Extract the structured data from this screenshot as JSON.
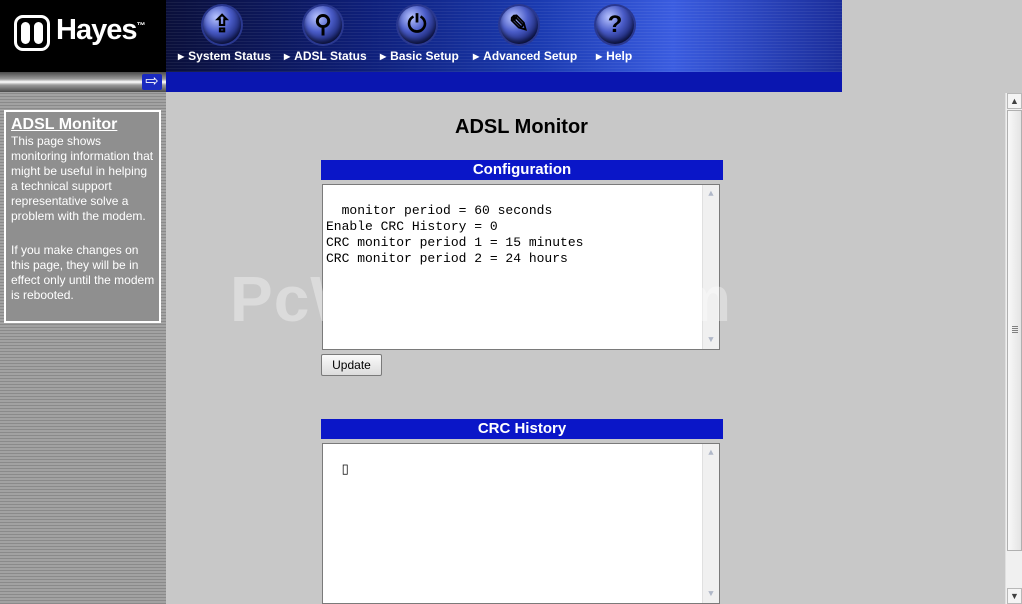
{
  "header": {
    "brand": "Hayes",
    "brand_mark": "™",
    "nav": [
      {
        "label": "System Status",
        "icon": "folder-icon",
        "glyph": "⇪"
      },
      {
        "label": "ADSL Status",
        "icon": "magnifier-icon",
        "glyph": "⚲"
      },
      {
        "label": "Basic Setup",
        "icon": "plug-icon",
        "glyph": "⏻"
      },
      {
        "label": "Advanced Setup",
        "icon": "wrench-icon",
        "glyph": "✎"
      },
      {
        "label": "Help",
        "icon": "question-icon",
        "glyph": "?"
      }
    ],
    "nav_bullet": "▶",
    "subbar_arrow": "⇨"
  },
  "sidebar": {
    "title": "ADSL Monitor",
    "p1": "This page shows monitoring information that might be useful in helping a technical support representative solve a problem with the modem.",
    "p2": "If you make changes on this page, they will be in effect only until the modem is rebooted."
  },
  "main": {
    "title": "ADSL Monitor",
    "configuration": {
      "header": "Configuration",
      "text": "monitor period = 60 seconds\nEnable CRC History = 0\nCRC monitor period 1 = 15 minutes\nCRC monitor period 2 = 24 hours",
      "button": "Update"
    },
    "crc_history": {
      "header": "CRC History",
      "text": "▯"
    }
  },
  "watermark": "PcWinTech.com",
  "scroll_arrows": {
    "up": "▲",
    "down": "▼"
  },
  "colors": {
    "header_blue": "#0a16c8",
    "page_bg": "#c8c8c8",
    "sidebar_gray": "#8f8f8f"
  }
}
